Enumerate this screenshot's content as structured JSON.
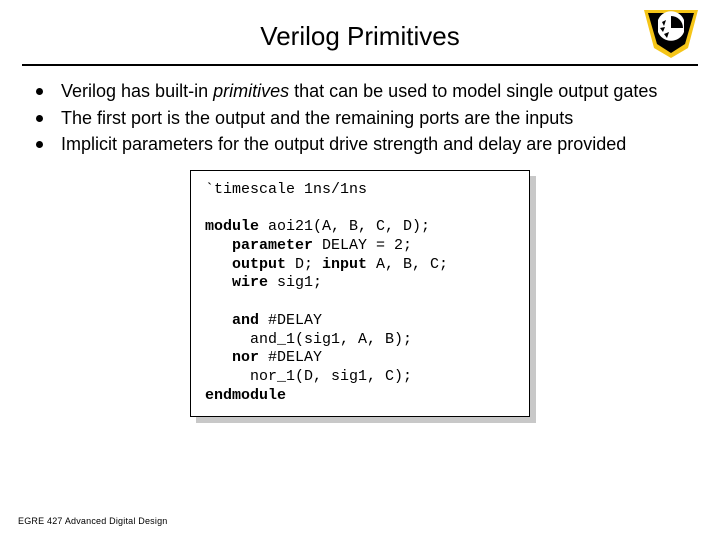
{
  "title": "Verilog Primitives",
  "bullets": [
    {
      "pre": "Verilog has built-in ",
      "em": "primitives",
      "post": " that can be used to model single output gates"
    },
    {
      "pre": "The first port is the output and the remaining ports are the inputs",
      "em": "",
      "post": ""
    },
    {
      "pre": "Implicit parameters for the output drive strength and delay are provided",
      "em": "",
      "post": ""
    }
  ],
  "code": {
    "l1": "`timescale 1ns/1ns",
    "l2a": "module",
    "l2b": " aoi21(A, B, C, D);",
    "l3a": "   parameter",
    "l3b": " DELAY = 2;",
    "l4a": "   output",
    "l4b": " D; ",
    "l4c": "input",
    "l4d": " A, B, C;",
    "l5a": "   wire",
    "l5b": " sig1;",
    "l6a": "   and",
    "l6b": " #DELAY",
    "l7": "     and_1(sig1, A, B);",
    "l8a": "   nor",
    "l8b": " #DELAY",
    "l9": "     nor_1(D, sig1, C);",
    "l10": "endmodule"
  },
  "footer": "EGRE 427 Advanced Digital Design"
}
